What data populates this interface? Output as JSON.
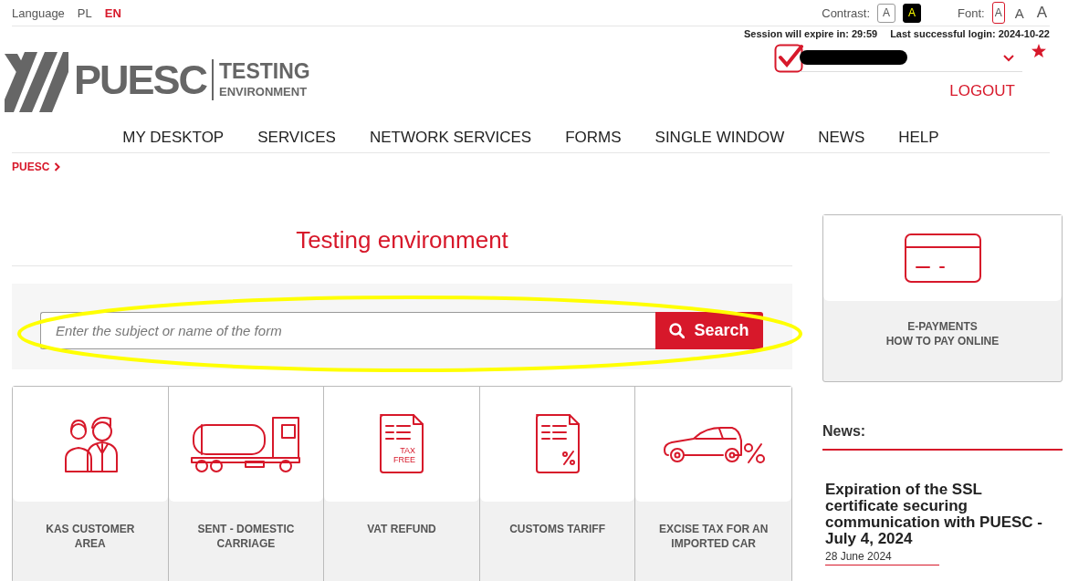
{
  "top_bar": {
    "language_label": "Language",
    "languages": [
      {
        "code": "PL",
        "selected": false
      },
      {
        "code": "EN",
        "selected": true
      }
    ],
    "contrast_label": "Contrast:",
    "contrast_options": [
      {
        "kind": "normal",
        "label": "A"
      },
      {
        "kind": "high",
        "label": "A"
      }
    ],
    "font_label": "Font:",
    "font_sizes": [
      {
        "label": "A",
        "selected": true
      },
      {
        "label": "A",
        "selected": false
      },
      {
        "label": "A",
        "selected": false
      }
    ]
  },
  "session": {
    "expire": "Session will expire in: 29:59",
    "last_login": "Last successful login: 2024-10-22"
  },
  "logo": {
    "name": "PUESC",
    "line1": "TESTING",
    "line2": "ENVIRONMENT"
  },
  "user": {
    "logout": "LOGOUT"
  },
  "nav": [
    {
      "label": "MY DESKTOP"
    },
    {
      "label": "SERVICES"
    },
    {
      "label": "NETWORK SERVICES"
    },
    {
      "label": "FORMS"
    },
    {
      "label": "SINGLE WINDOW"
    },
    {
      "label": "NEWS"
    },
    {
      "label": "HELP"
    }
  ],
  "breadcrumb": [
    {
      "label": "PUESC"
    }
  ],
  "page_title": "Testing environment",
  "search": {
    "placeholder": "Enter the subject or name of the form",
    "button": "Search"
  },
  "annotation": {
    "kind": "ellipse"
  },
  "tiles": [
    {
      "kind": "people",
      "label": "KAS CUSTOMER\nAREA"
    },
    {
      "kind": "truck",
      "label": "SENT - DOMESTIC\nCARRIAGE"
    },
    {
      "kind": "taxfree",
      "label": "VAT REFUND",
      "icon_text": "TAX\nFREE"
    },
    {
      "kind": "percentdoc",
      "label": "CUSTOMS TARIFF"
    },
    {
      "kind": "car",
      "label": "EXCISE TAX FOR AN\nIMPORTED CAR"
    }
  ],
  "side_card": {
    "kind": "card",
    "label": "E-PAYMENTS\nHOW TO PAY ONLINE"
  },
  "news": {
    "heading": "News:",
    "items": [
      {
        "title": "Expiration of the SSL certificate securing communication with PUESC - July 4, 2024",
        "date": "28 June 2024"
      }
    ]
  }
}
